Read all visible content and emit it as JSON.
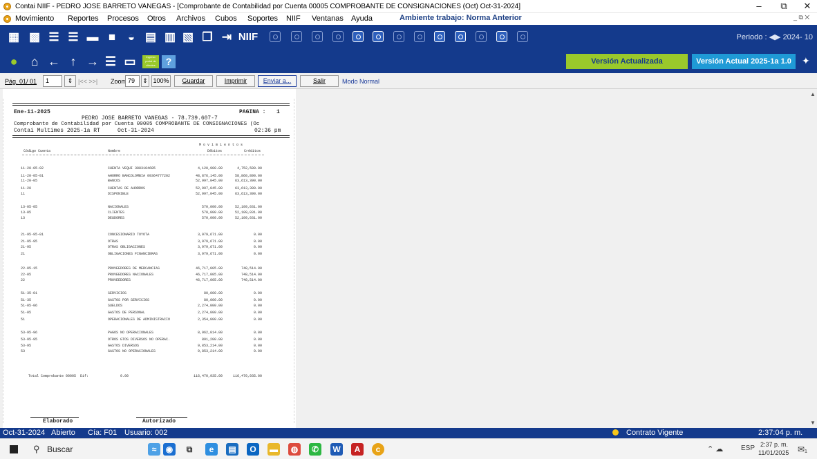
{
  "window": {
    "title": "Contai NIIF - PEDRO JOSE BARRETO VANEGAS - [Comprobante de Contabilidad por Cuenta 00005 COMPROBANTE DE CONSIGNACIONES (Oct) Oct-31-2024]",
    "minimize": "–",
    "maximize": "⧉",
    "close": "✕",
    "inner_controls": "_ ⧉ ✕"
  },
  "menu": {
    "items": [
      "Movimiento",
      "Reportes",
      "Procesos",
      "Otros",
      "Archivos",
      "Cubos",
      "Soportes",
      "NIIF",
      "Ventanas",
      "Ayuda"
    ],
    "environment": "Ambiente trabajo: Norma Anterior"
  },
  "toolbar1": {
    "niif_label": "NIIF",
    "period_label": "Periodo :",
    "period_value": "2024- 10"
  },
  "toolbar2": {
    "portal_label": "Ingreso portal de clientes",
    "version_updated": "Versión Actualizada",
    "version_current": "Versión Actual 2025-1a 1.0"
  },
  "nav": {
    "page_label": "Pág. 01/ 01",
    "page_input": "1",
    "first_last": "|<< >>|",
    "zoom_label": "Zoom",
    "zoom_value": "79",
    "zoom_100": "100%",
    "save": "Guardar",
    "print": "Imprimir",
    "send": "Enviar a...",
    "exit": "Salir",
    "mode": "Modo Normal"
  },
  "report": {
    "date": "Ene-11-2025",
    "page_label": "PAGINA :",
    "page_num": "1",
    "company": "PEDRO JOSE BARRETO VANEGAS - 78.739.607-7",
    "subtitle": "Comprobante de Contabilidad por Cuenta 00005 COMPROBANTE DE CONSIGNACIONES (Oc",
    "version": "Contai Multimes 2025-1a RT",
    "period": "Oct-31-2024",
    "time": "02:36 pm",
    "col_movs": "M o v i m i e n t o s",
    "col_code": "Código Cuenta",
    "col_name": "Nombre",
    "col_debit": "Débitos",
    "col_credit": "Créditos",
    "rows": [
      [
        "11-20-05-02",
        "CUENTA VEQUI 3883104685",
        "4,120,900.00",
        "4,752,500.00"
      ],
      [
        "11-20-05-01",
        "AHORRO BANCOLOMBIA 09364777202",
        "48,876,145.00",
        "58,860,890.00"
      ],
      [
        "11-20-05",
        "BANCOS",
        "52,997,045.00",
        "63,613,390.00"
      ],
      [
        "11-20",
        "CUENTAS DE AHORROS",
        "52,997,045.00",
        "63,613,390.00"
      ],
      [
        "11",
        "DISPONIBLE",
        "52,997,045.00",
        "63,613,390.00"
      ],
      [
        "13-05-05",
        "NACIONALES",
        "570,000.00",
        "52,109,031.00"
      ],
      [
        "13-05",
        "CLIENTES",
        "570,000.00",
        "52,109,031.00"
      ],
      [
        "13",
        "DEUDORES",
        "570,000.00",
        "52,109,031.00"
      ],
      [
        "21-95-95-01",
        "CONCESIONARIO TOYOTA",
        "3,979,671.00",
        "0.00"
      ],
      [
        "21-95-95",
        "OTRAS",
        "3,979,671.00",
        "0.00"
      ],
      [
        "21-95",
        "OTRAS OBLIGACIONES",
        "3,979,671.00",
        "0.00"
      ],
      [
        "21",
        "OBLIGACIONES FINANCIERAS",
        "3,979,671.00",
        "0.00"
      ],
      [
        "22-05-15",
        "PROVEEDORES DE MERCANCIAS",
        "46,717,005.00",
        "748,514.00"
      ],
      [
        "22-05",
        "PROVEEDORES NACIONALES",
        "46,717,005.00",
        "748,514.00"
      ],
      [
        "22",
        "PROVEEDORES",
        "46,717,005.00",
        "748,514.00"
      ],
      [
        "51-35-01",
        "SERVICIOS",
        "80,000.00",
        "0.00"
      ],
      [
        "51-35",
        "GASTOS POR SERVICIOS",
        "80,000.00",
        "0.00"
      ],
      [
        "51-05-06",
        "SUELDOS",
        "2,274,000.00",
        "0.00"
      ],
      [
        "51-05",
        "GASTOS DE PERSONAL",
        "2,274,000.00",
        "0.00"
      ],
      [
        "51",
        "OPERACIONALES DE ADMINISTRACIO",
        "2,354,000.00",
        "0.00"
      ],
      [
        "53-95-96",
        "PAGOS NO OPERACIONALES",
        "8,962,014.00",
        "0.00"
      ],
      [
        "53-95-95",
        "OTROS GTOS DIVERSOS NO OPERAC.",
        "891,200.00",
        "0.00"
      ],
      [
        "53-95",
        "GASTOS DIVERSOS",
        "9,853,214.00",
        "0.00"
      ],
      [
        "53",
        "GASTOS NO OPERACIONALES",
        "9,853,214.00",
        "0.00"
      ]
    ],
    "total_label": "Total Comprobante 00005  Dif:",
    "total_diff": "0.00",
    "total_debit": "116,470,935.00",
    "total_credit": "116,470,935.00",
    "signed_by": "Elaborado",
    "approved_by": "Autorizado"
  },
  "status": {
    "date": "Oct-31-2024",
    "state": "Abierto",
    "company": "Cía: F01",
    "user": "Usuario: 002",
    "contract": "Contrato Vigente",
    "clock": "2:37:04 p. m."
  },
  "taskbar": {
    "search": "Buscar",
    "lang": "ESP",
    "time": "2:37 p. m.",
    "date": "11/01/2025",
    "notif": "1"
  }
}
